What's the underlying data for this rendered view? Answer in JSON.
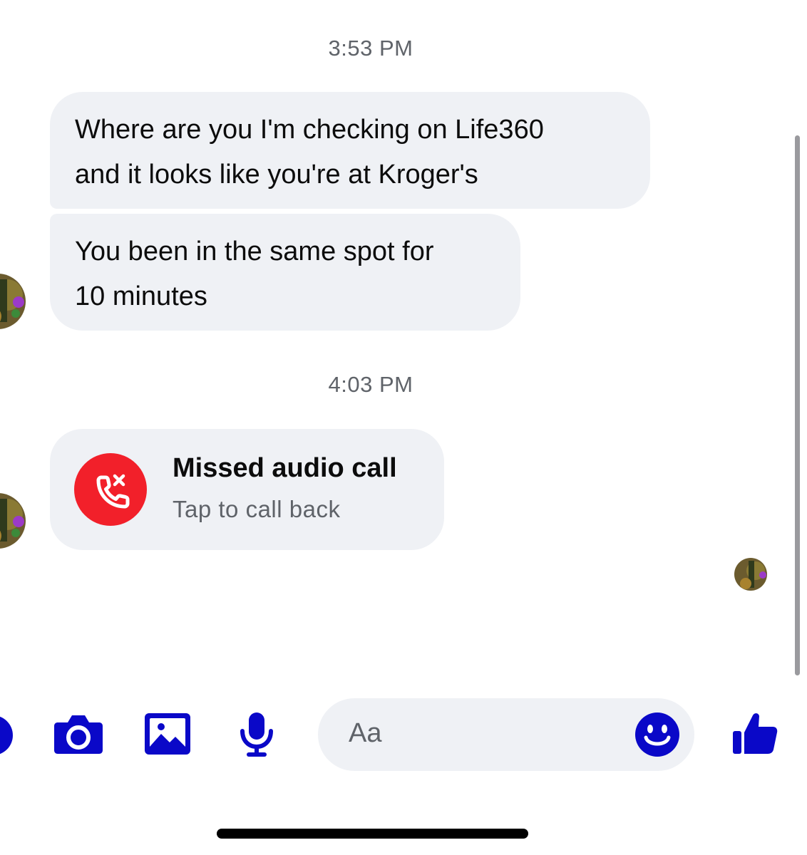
{
  "conversation": {
    "timestamps": [
      "3:53 PM",
      "4:03 PM"
    ],
    "messages": [
      {
        "line1": "Where are you I'm checking on Life360",
        "line2": "and it looks like you're at Kroger's"
      },
      {
        "line1": "You been in the same spot for",
        "line2": "10 minutes"
      }
    ],
    "missed_call": {
      "title": "Missed audio call",
      "subtitle": "Tap to call back"
    }
  },
  "composer": {
    "placeholder": "Aa"
  },
  "colors": {
    "accent": "#0a08c8",
    "bubble": "#eff1f5",
    "missed_call_red": "#f2202a",
    "timestamp_text": "#5f6369"
  },
  "icons": [
    "plus-icon",
    "camera-icon",
    "gallery-icon",
    "microphone-icon",
    "smiley-icon",
    "thumbs-up-icon",
    "missed-call-icon"
  ]
}
